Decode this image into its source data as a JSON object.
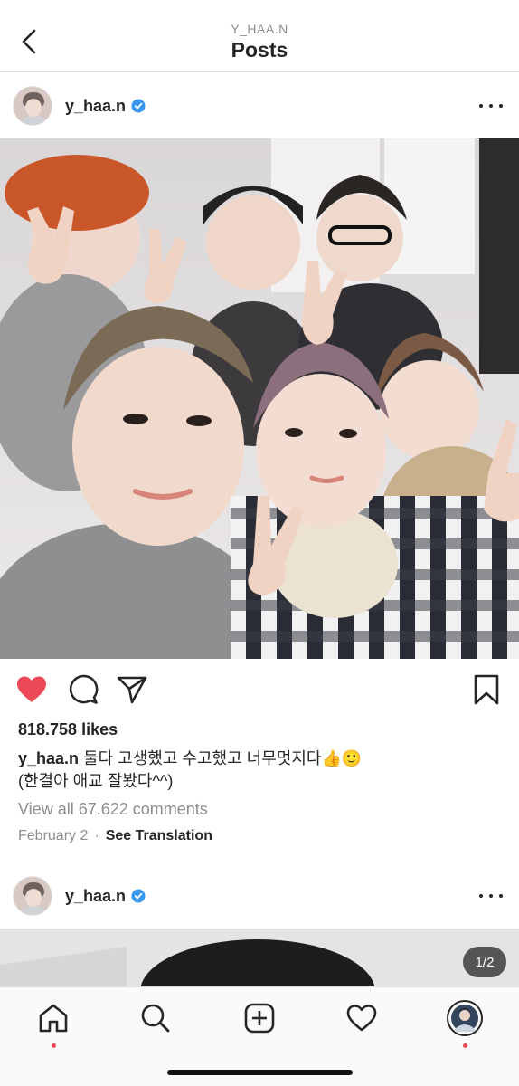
{
  "header": {
    "account": "Y_HAA.N",
    "title": "Posts",
    "back_icon": "chevron-left-icon"
  },
  "post": {
    "username": "y_haa.n",
    "verified_icon": "verified-badge-icon",
    "more_icon": "more-options-icon",
    "photo_description": "group selfie photo",
    "likes": "818.758 likes",
    "caption_user": "y_haa.n",
    "caption_text": "둘다 고생했고 수고했고 너무멋지다👍🙂",
    "caption_line2": "(한결아 애교 잘봤다^^)",
    "view_comments": "View all 67.622 comments",
    "date": "February 2",
    "separator": "·",
    "translate": "See Translation",
    "liked": true,
    "colors": {
      "like": "#ed4956",
      "text": "#262626",
      "muted": "#8e8e8e",
      "verified": "#3897f0"
    }
  },
  "next_post": {
    "username": "y_haa.n",
    "carousel_counter": "1/2"
  },
  "tabbar": {
    "items": [
      "home-icon",
      "search-icon",
      "new-post-icon",
      "activity-heart-icon",
      "profile-avatar"
    ]
  }
}
